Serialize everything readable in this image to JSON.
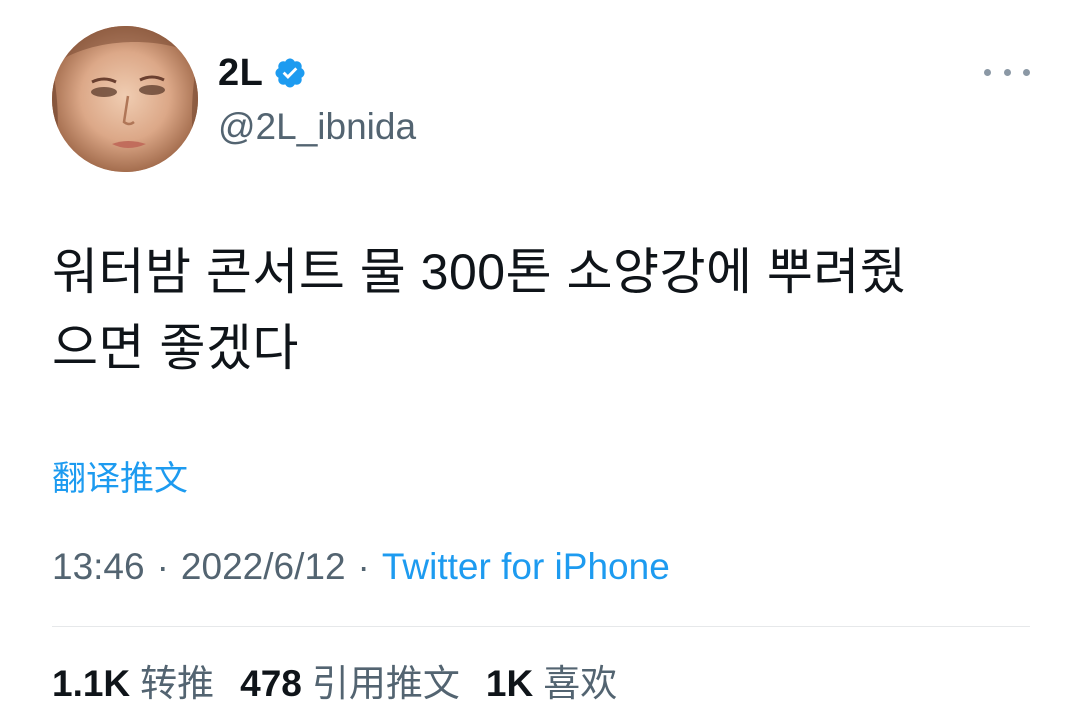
{
  "author": {
    "display_name": "2L",
    "handle": "@2L_ibnida",
    "verified": true
  },
  "icons": {
    "verified": "verified-badge-icon",
    "more": "more-options-icon"
  },
  "tweet": {
    "text": "워터밤 콘서트 물 300톤 소양강에 뿌려줬\n으면 좋겠다",
    "translate_label": "翻译推文",
    "time": "13:46",
    "date": "2022/6/12",
    "separator": "·",
    "source": "Twitter for iPhone"
  },
  "stats": [
    {
      "count": "1.1K",
      "label": "转推"
    },
    {
      "count": "478",
      "label": "引用推文"
    },
    {
      "count": "1K",
      "label": "喜欢"
    }
  ],
  "colors": {
    "accent": "#1d9bf0",
    "secondary_text": "#536471",
    "primary_text": "#0f1419"
  }
}
